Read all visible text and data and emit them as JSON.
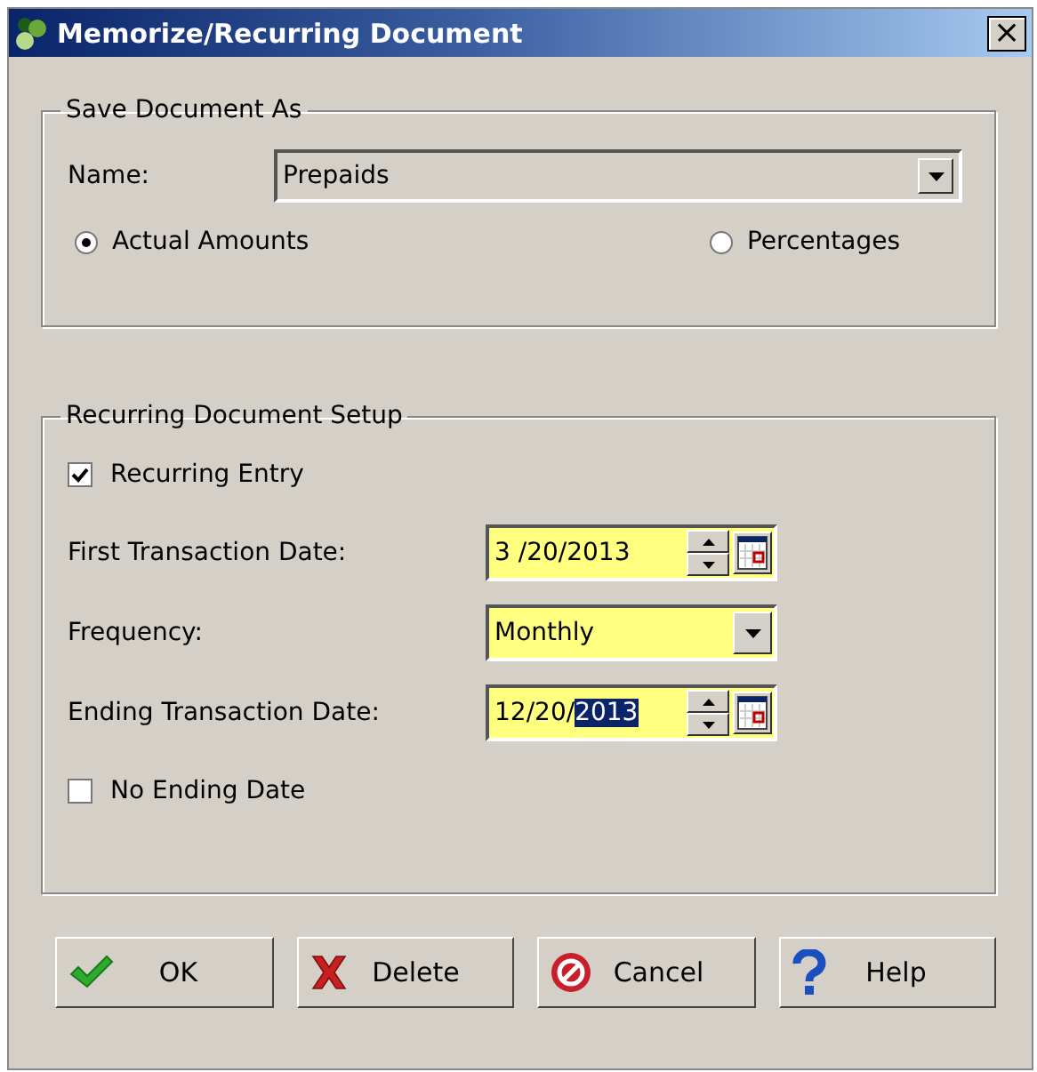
{
  "window": {
    "title": "Memorize/Recurring Document",
    "close": "×"
  },
  "save_group": {
    "title": "Save Document As",
    "name_label": "Name:",
    "name_value": "Prepaids",
    "options": [
      {
        "label": "Actual Amounts",
        "selected": true
      },
      {
        "label": "Percentages",
        "selected": false
      }
    ]
  },
  "setup_group": {
    "title": "Recurring Document Setup",
    "rows": [
      {
        "kind": "checkbox",
        "label": "Recurring Entry",
        "checked": true
      },
      {
        "kind": "date",
        "label": "First Transaction Date:",
        "value": "3 /20/2013"
      },
      {
        "kind": "dropdown",
        "label": "Frequency:",
        "value": "Monthly"
      },
      {
        "kind": "date",
        "label": "Ending Transaction Date:",
        "value": "12/20/",
        "selected_text": "2013"
      },
      {
        "kind": "checkbox",
        "label": "No Ending Date",
        "checked": false
      }
    ]
  },
  "buttons": [
    {
      "kind": "ok",
      "label": "OK"
    },
    {
      "kind": "delete",
      "label": "Delete"
    },
    {
      "kind": "cancel",
      "label": "Cancel"
    },
    {
      "kind": "help",
      "label": "Help"
    }
  ]
}
